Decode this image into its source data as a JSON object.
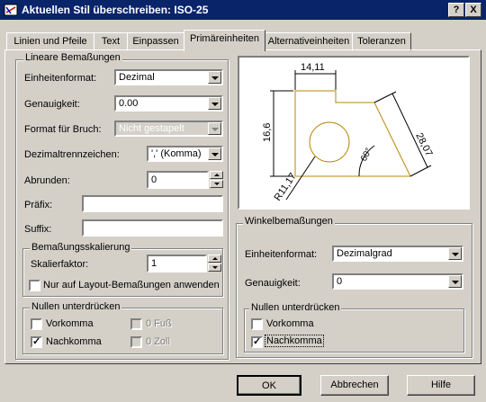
{
  "window": {
    "title": "Aktuellen Stil überschreiben: ISO-25",
    "help_btn": "?",
    "close_btn": "X"
  },
  "tabs": [
    "Linien und Pfeile",
    "Text",
    "Einpassen",
    "Primäreinheiten",
    "Alternativeinheiten",
    "Toleranzen"
  ],
  "active_tab": "Primäreinheiten",
  "linear": {
    "group_title": "Lineare Bemaßungen",
    "unit_format": {
      "label": "Einheitenformat:",
      "value": "Dezimal"
    },
    "precision": {
      "label": "Genauigkeit:",
      "value": "0.00"
    },
    "fraction_format": {
      "label": "Format für Bruch:",
      "value": "Nicht gestapelt"
    },
    "decimal_separator": {
      "label": "Dezimaltrennzeichen:",
      "value": "',' (Komma)"
    },
    "round_off": {
      "label": "Abrunden:",
      "value": "0"
    },
    "prefix": {
      "label": "Präfix:",
      "value": ""
    },
    "suffix": {
      "label": "Suffix:",
      "value": ""
    },
    "scale": {
      "group_title": "Bemaßungsskalierung",
      "label": "Skalierfaktor:",
      "value": "1",
      "layout_only_label": "Nur auf Layout-Bemaßungen anwenden",
      "layout_only_checked": false
    },
    "zero": {
      "group_title": "Nullen unterdrücken",
      "leading": "Vorkomma",
      "leading_checked": false,
      "trailing": "Nachkomma",
      "trailing_checked": true,
      "feet": "0 Fuß",
      "inches": "0 Zoll"
    }
  },
  "preview": {
    "dim_top": "14,11",
    "dim_left": "16,6",
    "dim_right": "28,07",
    "dim_angle": "60°",
    "dim_radius": "R11,17"
  },
  "angular": {
    "group_title": "Winkelbemaßungen",
    "unit_format": {
      "label": "Einheitenformat:",
      "value": "Dezimalgrad"
    },
    "precision": {
      "label": "Genauigkeit:",
      "value": "0"
    },
    "zero": {
      "group_title": "Nullen unterdrücken",
      "leading": "Vorkomma",
      "leading_checked": false,
      "trailing": "Nachkomma",
      "trailing_checked": true
    }
  },
  "buttons": {
    "ok": "OK",
    "cancel": "Abbrechen",
    "help": "Hilfe"
  },
  "colors": {
    "titlebar": "#0a246a",
    "face": "#d4d0c8",
    "preview_part": "#b8860b"
  }
}
